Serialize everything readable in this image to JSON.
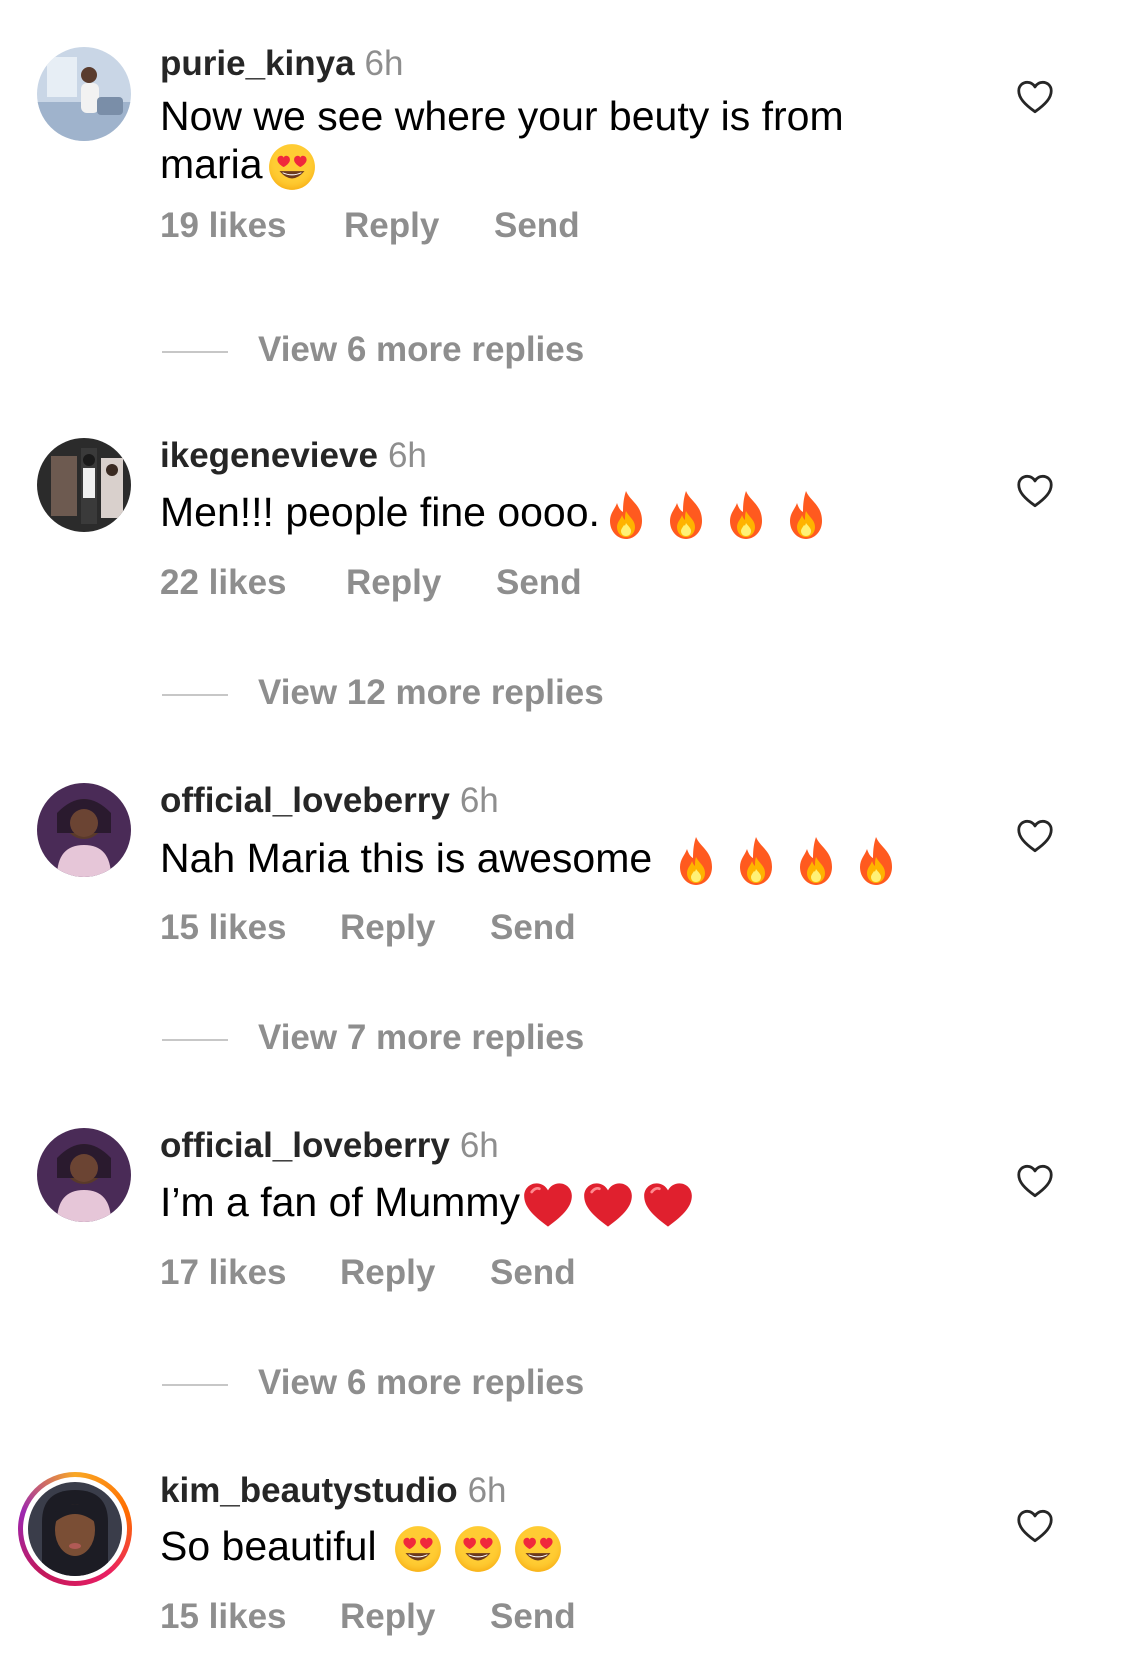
{
  "comments": [
    {
      "username": "purie_kinya",
      "time": "6h",
      "text_line1": "Now we see where your beuty is from",
      "text_line2": "maria",
      "likes": "19 likes",
      "reply": "Reply",
      "send": "Send",
      "view_more": "View 6 more replies",
      "emoji": [
        "heart-eyes"
      ]
    },
    {
      "username": "ikegenevieve",
      "time": "6h",
      "text": "Men!!! people fine  oooo.",
      "likes": "22 likes",
      "reply": "Reply",
      "send": "Send",
      "view_more": "View 12 more replies",
      "emoji": [
        "fire",
        "fire",
        "fire",
        "fire"
      ]
    },
    {
      "username": "official_loveberry",
      "time": "6h",
      "text": "Nah Maria this is awesome",
      "likes": "15 likes",
      "reply": "Reply",
      "send": "Send",
      "view_more": "View 7 more replies",
      "emoji": [
        "fire",
        "fire",
        "fire",
        "fire"
      ]
    },
    {
      "username": "official_loveberry",
      "time": "6h",
      "text": "I’m a fan of Mummy",
      "likes": "17 likes",
      "reply": "Reply",
      "send": "Send",
      "view_more": "View 6 more replies",
      "emoji": [
        "red-heart",
        "red-heart",
        "red-heart"
      ]
    },
    {
      "username": "kim_beautystudio",
      "time": "6h",
      "text": "So beautiful",
      "likes": "15 likes",
      "reply": "Reply",
      "send": "Send",
      "emoji": [
        "heart-eyes",
        "heart-eyes",
        "heart-eyes"
      ],
      "story_ring": true
    }
  ],
  "icons": {
    "like": "heart-outline-icon"
  },
  "colors": {
    "text": "#000000",
    "username": "#262626",
    "muted": "#8e8e8e",
    "divider": "#c7c7c7"
  }
}
